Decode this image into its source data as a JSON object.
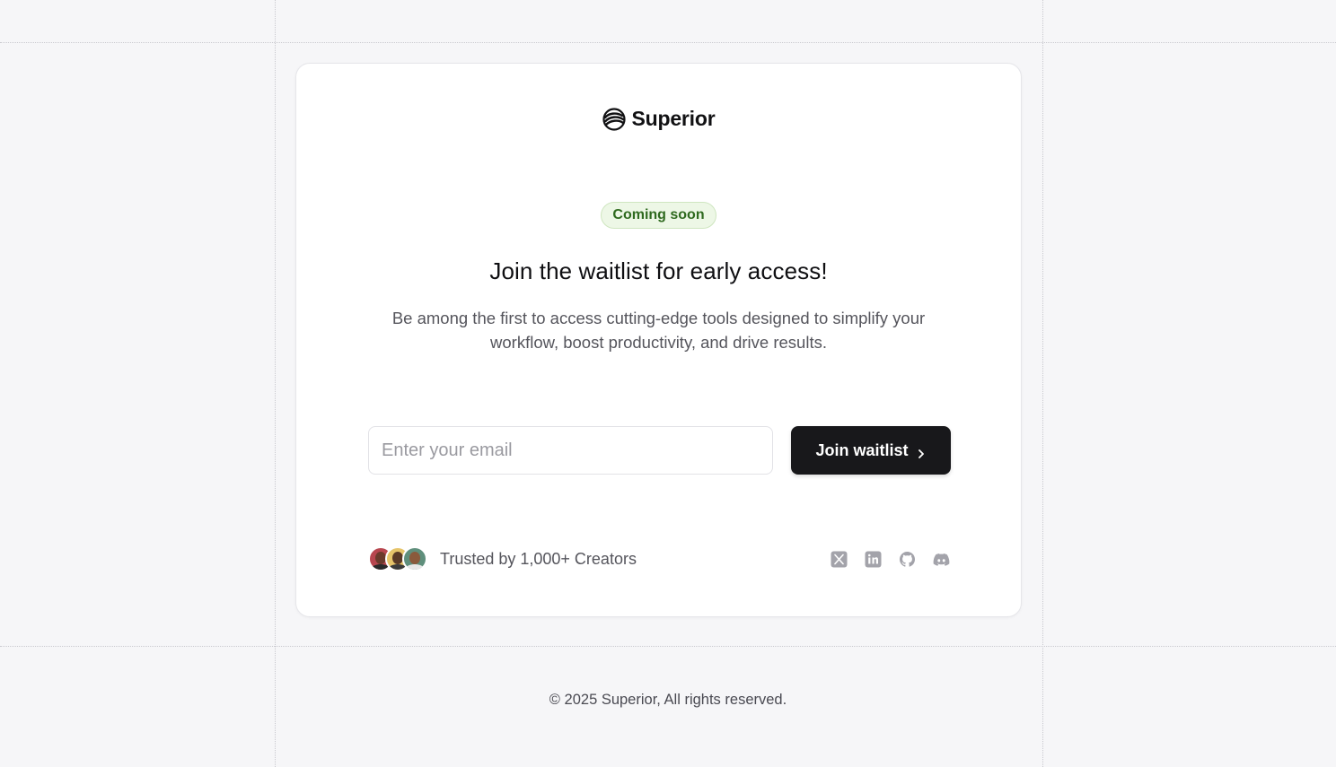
{
  "brand": {
    "name": "Superior",
    "logo_icon": "superior-logo-icon"
  },
  "badge": {
    "label": "Coming soon",
    "color": "#2f6a1f",
    "background": "#edf7e6"
  },
  "hero": {
    "headline": "Join the waitlist for early access!",
    "subtext": "Be among the first to access cutting-edge tools designed to simplify your workflow, boost productivity, and drive results."
  },
  "form": {
    "email_placeholder": "Enter your email",
    "email_value": "",
    "submit_label": "Join waitlist",
    "submit_icon": "chevron-right-icon",
    "button_color": "#18181b"
  },
  "trust": {
    "text": "Trusted by 1,000+ Creators",
    "avatars": [
      "avatar-1",
      "avatar-2",
      "avatar-3"
    ]
  },
  "socials": [
    {
      "name": "x-twitter-icon"
    },
    {
      "name": "linkedin-icon"
    },
    {
      "name": "github-icon"
    },
    {
      "name": "discord-icon"
    }
  ],
  "footer": {
    "copyright": "© 2025 Superior, All rights reserved."
  }
}
